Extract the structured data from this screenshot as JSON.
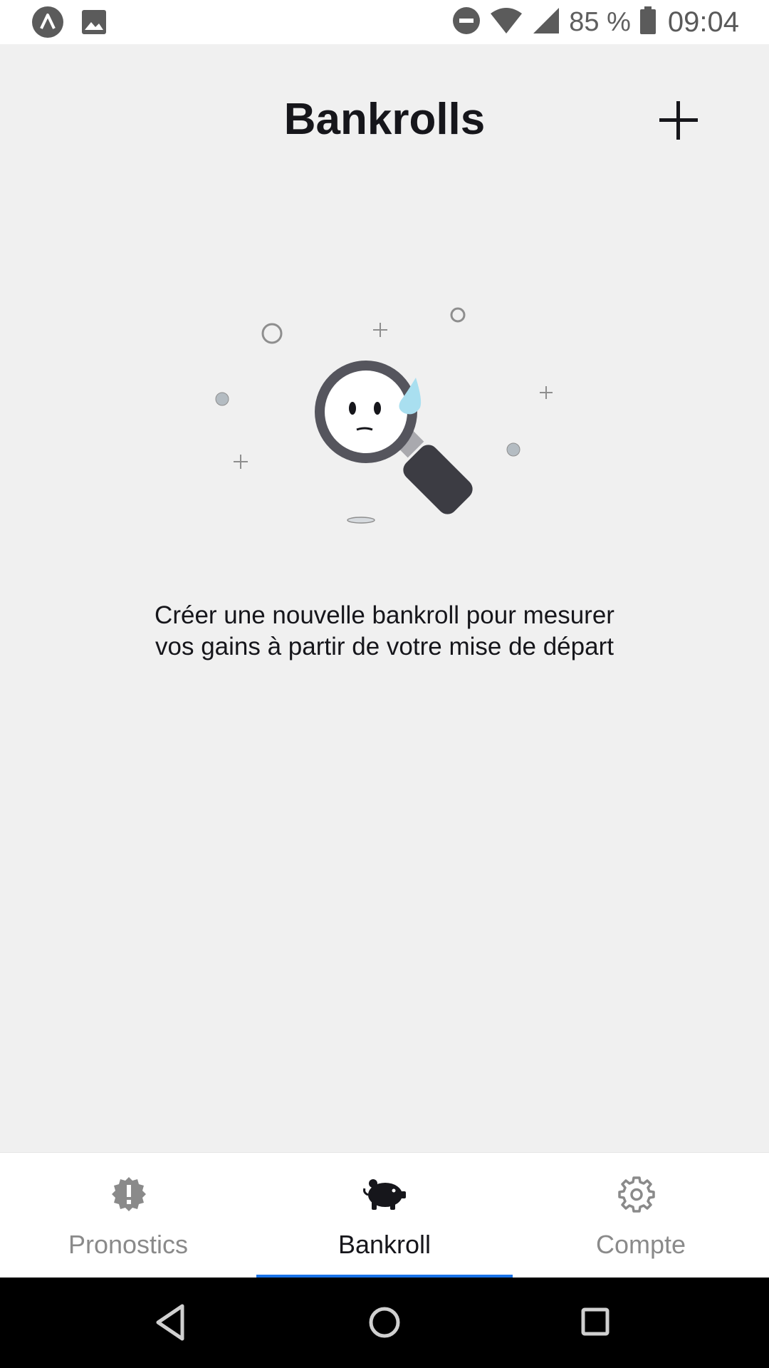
{
  "status_bar": {
    "battery_text": "85 %",
    "time": "09:04",
    "icons": [
      "app-notification-icon",
      "image-notification-icon",
      "do-not-disturb-icon",
      "wifi-icon",
      "cell-signal-icon",
      "battery-icon"
    ]
  },
  "header": {
    "title": "Bankrolls",
    "add_icon": "plus-icon"
  },
  "empty_state": {
    "illustration": "magnifying-glass-sad-face",
    "line1": "Créer une nouvelle bankroll pour mesurer",
    "line2": "vos gains à partir de votre mise de départ"
  },
  "bottom_nav": {
    "active_tab": "Bankroll",
    "accent_color": "#1a73e8",
    "tabs": [
      {
        "label": "Pronostics",
        "icon": "alert-badge-icon"
      },
      {
        "label": "Bankroll",
        "icon": "piggy-bank-icon"
      },
      {
        "label": "Compte",
        "icon": "gear-icon"
      }
    ]
  },
  "system_nav": {
    "buttons": [
      "back-icon",
      "home-icon",
      "recents-icon"
    ]
  }
}
